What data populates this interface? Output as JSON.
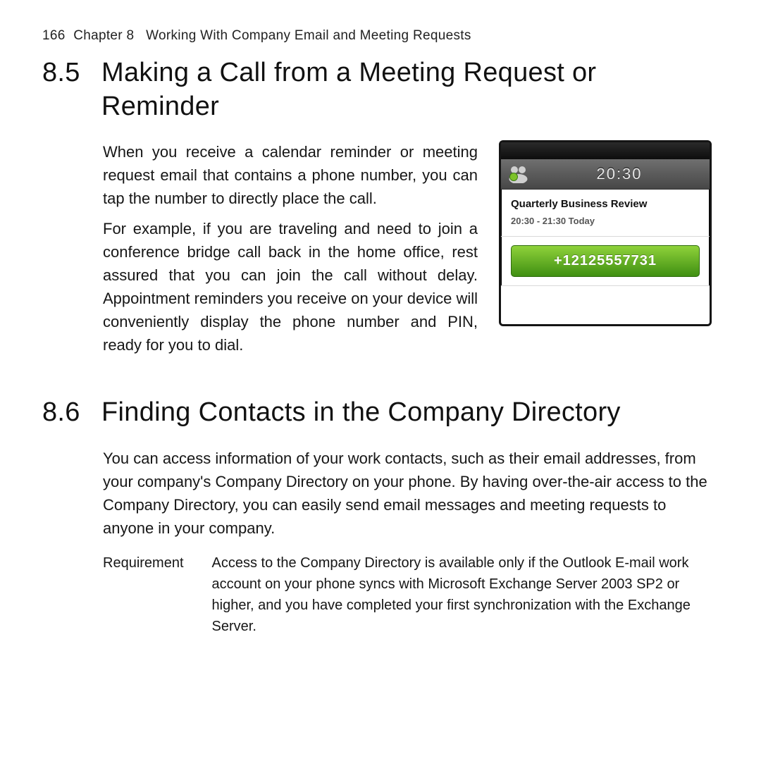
{
  "header": {
    "page_number": "166",
    "chapter_label": "Chapter 8",
    "chapter_title": "Working With Company Email and Meeting Requests"
  },
  "section_85": {
    "number": "8.5",
    "title": "Making a Call from a Meeting Request or Reminder",
    "para1": "When you receive a calendar reminder or meeting request email that contains a phone number, you can tap the number to directly place the call.",
    "para2": "For example, if you are traveling and need to join a conference bridge call back in the home office, rest assured that you can join the call without delay. Appointment reminders you receive on your device will conveniently display the phone number and PIN, ready for you to dial."
  },
  "phone_widget": {
    "clock": "20:30",
    "event_title": "Quarterly Business Review",
    "event_time": "20:30 - 21:30 Today",
    "dial_number": "+12125557731"
  },
  "section_86": {
    "number": "8.6",
    "title": "Finding Contacts in the Company Directory",
    "para1": "You can access information of your work contacts, such as their email addresses, from your company's Company Directory on your phone. By having over-the-air access to the Company Directory, you can easily send email messages and meeting requests to anyone in your company.",
    "requirement_label": "Requirement",
    "requirement_text_a": "Access to the Company Directory is available only if the Outlook E-mail work account on your phone syncs with ",
    "requirement_strong": "Microsoft Exchange Server 2003 SP2 or higher",
    "requirement_text_b": ", and you have completed your first synchronization with the Exchange Server."
  }
}
